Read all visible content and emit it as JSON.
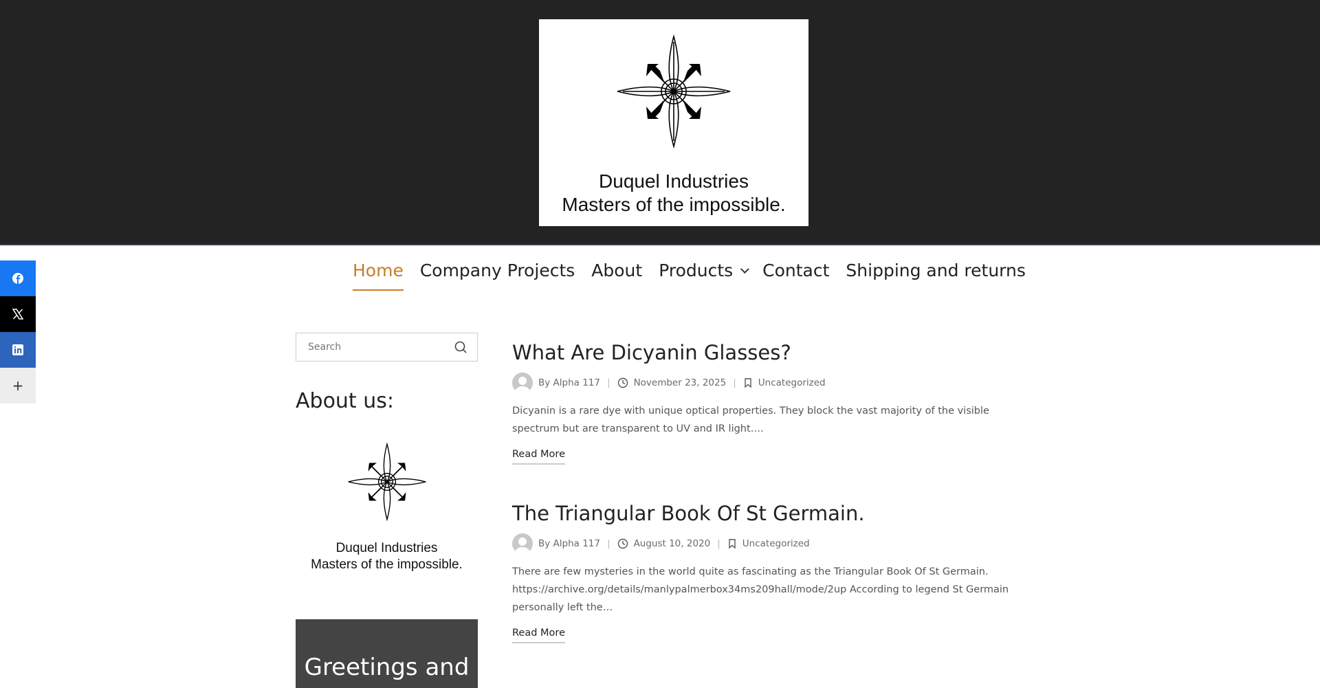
{
  "brand": {
    "name": "Duquel Industries",
    "tagline": "Masters of the impossible."
  },
  "nav": {
    "items": [
      {
        "label": "Home",
        "active": true
      },
      {
        "label": "Company Projects"
      },
      {
        "label": "About"
      },
      {
        "label": "Products",
        "has_dropdown": true
      },
      {
        "label": "Contact"
      },
      {
        "label": "Shipping and returns"
      }
    ]
  },
  "social": [
    {
      "name": "facebook-icon",
      "glyph": "f",
      "color": "#1877f2"
    },
    {
      "name": "x-icon",
      "glyph": "𝕏",
      "color": "#000000"
    },
    {
      "name": "linkedin-icon",
      "glyph": "in",
      "color": "#2d64bc"
    },
    {
      "name": "more-icon",
      "glyph": "+",
      "color": "#ededed"
    }
  ],
  "sidebar": {
    "search_placeholder": "Search",
    "about_title": "About us:",
    "logo_name": "Duquel Industries",
    "logo_tagline": "Masters of the impossible.",
    "greeting_text": "Greetings and"
  },
  "posts": [
    {
      "title": "What Are Dicyanin Glasses?",
      "author": "By Alpha 117",
      "date": "November 23, 2025",
      "category": "Uncategorized",
      "excerpt": "Dicyanin is a rare dye with unique optical properties. They block the vast majority of the visible spectrum but are transparent to UV and IR light….",
      "read_more": "Read More"
    },
    {
      "title": "The Triangular Book Of St Germain.",
      "author": "By Alpha 117",
      "date": "August 10, 2020",
      "category": "Uncategorized",
      "excerpt": "There are few mysteries in the world quite as fascinating as the Triangular Book Of St Germain. https://archive.org/details/manlypalmerbox34ms209hall/mode/2up According to legend St Germain personally left the…",
      "read_more": "Read More"
    }
  ],
  "colors": {
    "accent": "#c97d26",
    "header_bg": "#232323"
  }
}
